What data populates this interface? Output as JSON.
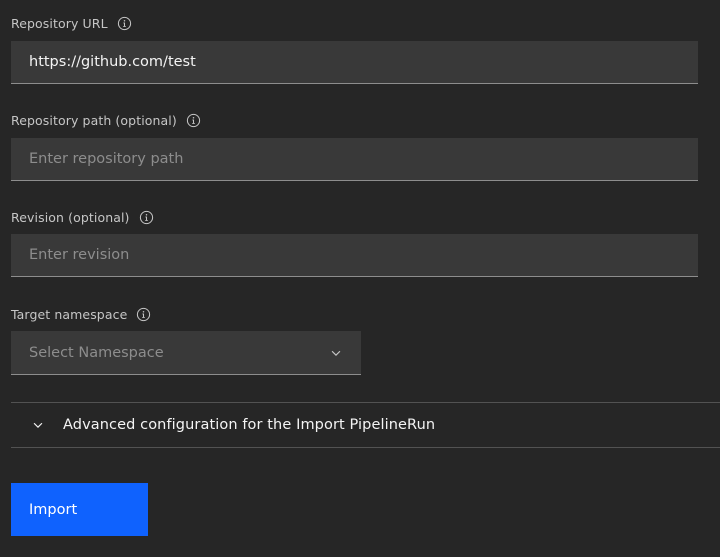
{
  "fields": {
    "repo_url": {
      "label": "Repository URL",
      "value": "https://github.com/test",
      "placeholder": ""
    },
    "repo_path": {
      "label": "Repository path (optional)",
      "value": "",
      "placeholder": "Enter repository path"
    },
    "revision": {
      "label": "Revision (optional)",
      "value": "",
      "placeholder": "Enter revision"
    },
    "namespace": {
      "label": "Target namespace",
      "selected": "Select Namespace"
    }
  },
  "advanced": {
    "title": "Advanced configuration for the Import PipelineRun",
    "expanded": false
  },
  "actions": {
    "import_label": "Import"
  },
  "icons": {
    "info": "information-icon",
    "dropdown": "chevron-down-icon"
  },
  "colors": {
    "background": "#262626",
    "field": "#393939",
    "primary_button": "#0f62fe",
    "divider": "#525252"
  }
}
